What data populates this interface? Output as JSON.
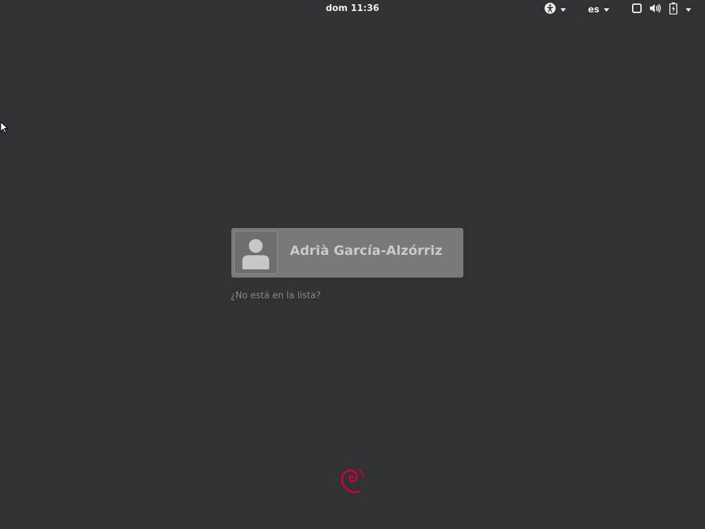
{
  "topbar": {
    "clock": "dom 11:36",
    "language": "es",
    "icons": [
      "accessibility-icon",
      "window-icon",
      "volume-icon",
      "battery-icon"
    ]
  },
  "login": {
    "user_name": "Adrià García-Alzórriz",
    "not_listed": "¿No está en la lista?"
  },
  "branding": {
    "logo": "debian-swirl-icon",
    "logo_color": "#c70036"
  },
  "colors": {
    "background": "#303335",
    "card": "#77797a",
    "text": "#eeeeec"
  }
}
